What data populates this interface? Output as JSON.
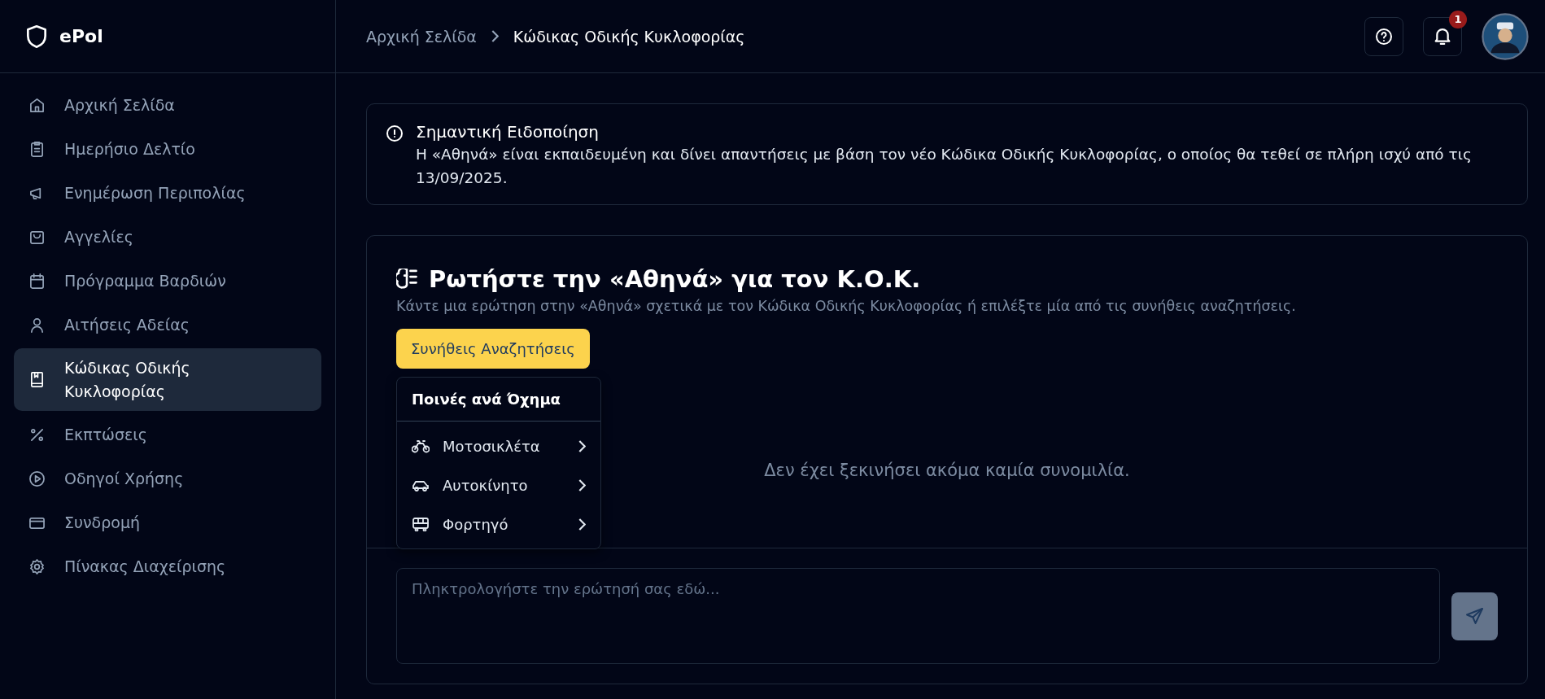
{
  "brand": "ePol",
  "sidebar": {
    "items": [
      {
        "label": "Αρχική Σελίδα",
        "selected": false
      },
      {
        "label": "Ημερήσιο Δελτίο",
        "selected": false
      },
      {
        "label": "Ενημέρωση Περιπολίας",
        "selected": false
      },
      {
        "label": "Αγγελίες",
        "selected": false
      },
      {
        "label": "Πρόγραμμα Βαρδιών",
        "selected": false
      },
      {
        "label": "Αιτήσεις Αδείας",
        "selected": false
      },
      {
        "label": "Κώδικας Οδικής Κυκλοφορίας",
        "selected": true
      },
      {
        "label": "Εκπτώσεις",
        "selected": false
      },
      {
        "label": "Οδηγοί Χρήσης",
        "selected": false
      },
      {
        "label": "Συνδρομή",
        "selected": false
      },
      {
        "label": "Πίνακας Διαχείρισης",
        "selected": false
      }
    ]
  },
  "breadcrumb": [
    "Αρχική Σελίδα",
    "Κώδικας Οδικής Κυκλοφορίας"
  ],
  "notifications_badge": "1",
  "alert": {
    "title": "Σημαντική Ειδοποίηση",
    "text": "Η «Αθηνά» είναι εκπαιδευμένη και δίνει απαντήσεις με βάση τον νέο Κώδικα Οδικής Κυκλοφορίας, ο οποίος θα τεθεί σε πλήρη ισχύ από τις 13/09/2025."
  },
  "chat": {
    "title": "Ρωτήστε την «Αθηνά» για τον Κ.Ο.Κ.",
    "subtitle": "Κάντε μια ερώτηση στην «Αθηνά» σχετικά με τον Κώδικα Οδικής Κυκλοφορίας ή επιλέξτε μία από τις συνήθεις αναζητήσεις.",
    "common_button": "Συνήθεις Αναζητήσεις",
    "empty_text": "Δεν έχει ξεκινήσει ακόμα καμία συνομιλία.",
    "input": {
      "placeholder": "Πληκτρολογήστε την ερώτησή σας εδώ..."
    }
  },
  "dropdown": {
    "header": "Ποινές ανά Όχημα",
    "items": [
      {
        "label": "Μοτοσικλέτα"
      },
      {
        "label": "Αυτοκίνητο"
      },
      {
        "label": "Φορτηγό"
      }
    ]
  }
}
